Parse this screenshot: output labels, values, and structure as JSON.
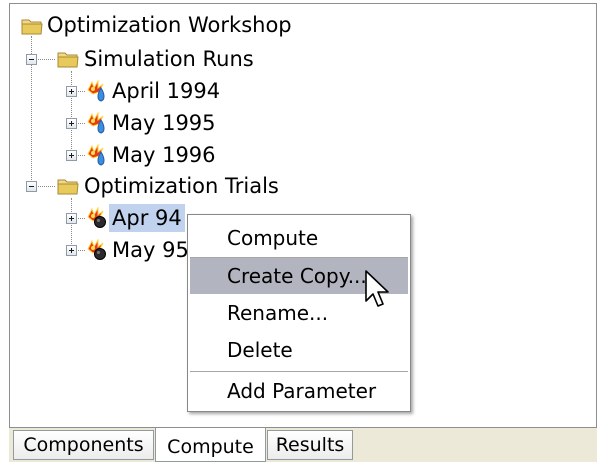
{
  "tree": {
    "root": {
      "label": "Optimization Workshop",
      "icon": "folder-icon"
    },
    "groups": [
      {
        "label": "Simulation Runs",
        "icon": "folder-icon",
        "expanded": true,
        "items": [
          {
            "label": "April 1994",
            "icon": "simulation-run-icon"
          },
          {
            "label": "May 1995",
            "icon": "simulation-run-icon"
          },
          {
            "label": "May 1996",
            "icon": "simulation-run-icon"
          }
        ]
      },
      {
        "label": "Optimization Trials",
        "icon": "folder-icon",
        "expanded": true,
        "items": [
          {
            "label": "Apr 94",
            "icon": "optimization-trial-icon",
            "selected": true
          },
          {
            "label": "May 95",
            "icon": "optimization-trial-icon"
          }
        ]
      }
    ]
  },
  "context_menu": {
    "items": [
      {
        "label": "Compute"
      },
      {
        "label": "Create Copy...",
        "hovered": true
      },
      {
        "label": "Rename..."
      },
      {
        "label": "Delete"
      },
      {
        "label": "Add Parameter"
      }
    ]
  },
  "tabs": [
    {
      "label": "Components",
      "active": false
    },
    {
      "label": "Compute",
      "active": true
    },
    {
      "label": "Results",
      "active": false
    }
  ],
  "colors": {
    "selection": "#c1d2ee",
    "menu_hover": "#b2b4bf",
    "folder": "#e8c95c",
    "tab_bar": "#ece9d8"
  }
}
